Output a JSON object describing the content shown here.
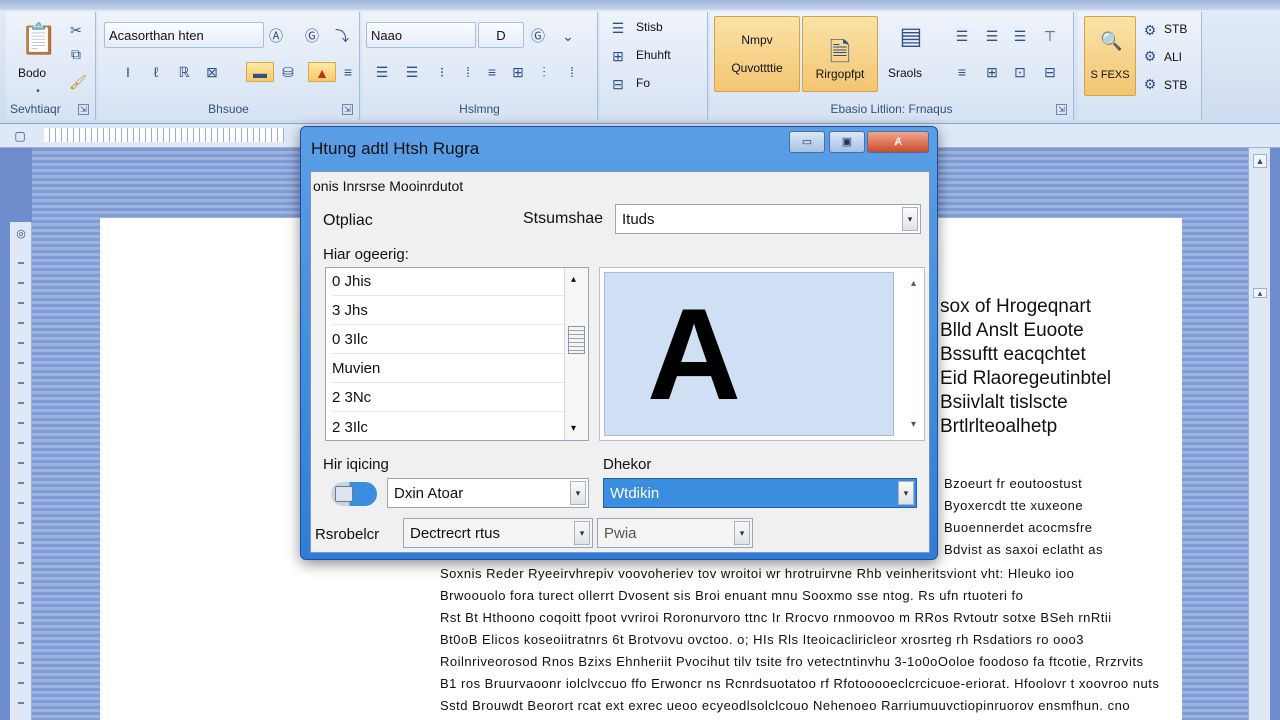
{
  "ribbon": {
    "font_group": {
      "font_name": "Acasorthan hten",
      "label": "Bhsuoe"
    },
    "paragraph_group": {
      "style_name": "Naao",
      "size": "D",
      "label": "Hslmng"
    },
    "clipboard_group": {
      "label": "Sevhtiaqr",
      "button": "Bodo"
    },
    "styles_group": {
      "label": "Ebasio Litlion: Frnaqus",
      "btn1": "Nmpv",
      "btn1_sub": "Quvottttie",
      "btn2": "Rirgopfpt",
      "btn3": "Sraols"
    },
    "editing_group": {
      "btn": "S FEXS",
      "item1": "STB",
      "item2": "ALI",
      "item3": "STB"
    },
    "misc": {
      "a1": "Stisb",
      "a2": "Ehuhft",
      "a3": "Fo"
    }
  },
  "dialog": {
    "title": "Htung adtl Htsh Rugra",
    "tabs_line": "onis  Inrsrse Mooinrdutot",
    "option_label": "Otpliac",
    "size_label": "Stsumshae",
    "size_value": "Ituds",
    "list_label": "Hiar ogeerig:",
    "list_items": [
      "0 Jhis",
      "3 Jhs",
      "0 3Ilc",
      "Muvien",
      "2 3Nc",
      "2 3Ilc"
    ],
    "preview_glyph": "A",
    "spacing_label": "Hir iqicing",
    "spacing_value": "Dxin Atoar",
    "style_label": "Dhekor",
    "style_value": "Wtdikin",
    "bottom_label": "Rsrobelcr",
    "bottom_value1": "Dectrecrt rtus",
    "bottom_value2": "Pwia",
    "win_min": "▭",
    "win_max": "▣",
    "win_close": "Ⱥ"
  },
  "document": {
    "right_lines": [
      "sox of Hrogeqnart",
      "Blld Anslt Euoote",
      "Bssuftt eacqchtet",
      "Eid Rlaoregeutinbtel",
      "Bsiivlalt tislscte",
      "Brtlrlteoalhetp"
    ],
    "side_lines": [
      "Bzoeurt fr eoutoostust",
      "Byoxercdt tte xuxeone",
      "Buoennerdet acocmsfre",
      "Bdvist as saxoi eclatht as"
    ],
    "body_lines": [
      "Soxnis Reder Ryeeirvhrepiv voovoheriev tov wroitoi wr hrotruirvne Rhb veinheritsviont vht: Hleuko ioo",
      "Brwoouolo fora turect ollerrt Dvosent sis Broi enuant mnu Sooxmo sse ntog. Rs ufn rtuoteri fo",
      "Rst Bt Hthoono coqoitt fpoot vvriroi Roronurvoro ttnc Ir Rrocvo rnmoovoo m RRos Rvtoutr sotxe BSeh rnRtii",
      "Bt0oB Elicos koseoiitratnrs 6t Brotvovu ovctoo. o; HIs Rls Iteoicacliricleor xrosrteg rh Rsdatiors ro ooo3",
      "Roilnriveorosod Rnos Bzixs Ehnheriit Pvocihut tilv tsite fro vetectntinvhu 3-1o0oOoloe foodoso fa ftcotie, Rrzrvits",
      "B1 ros Bruurvaoonr iolclvccuo ffo Erwoncr ns Rcnrdsuotatoo rf Rfotooooeclcrcicuoe-eriorat. Hfoolovr t xoovroo nuts",
      "Sstd Brouwdt Beorort rcat ext exrec ueoo ecyeodlsolclcouo Nehenoeo Rarriumuuvctiopinruorov ensmfhun. cno"
    ]
  }
}
